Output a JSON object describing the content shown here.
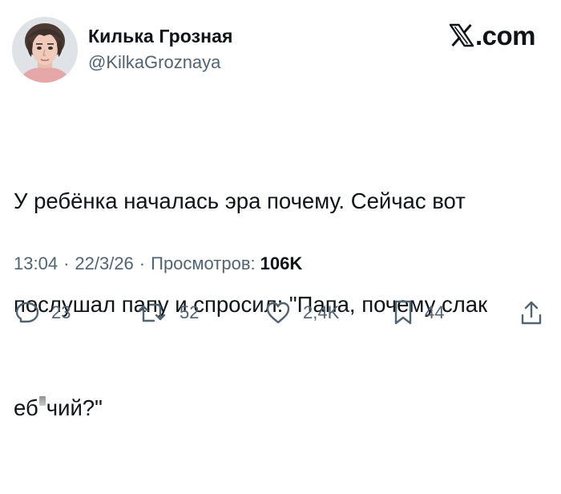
{
  "header": {
    "display_name": "Килька Грозная",
    "handle": "@KilkaGroznaya",
    "brand": "𝕏.com",
    "brand_text": ".com"
  },
  "tweet": {
    "line1": "У ребёнка началась эра почему. Сейчас вот",
    "line2": "послушал папу и спросил: \"Папа, почему слак",
    "line3_start": "еб",
    "line3_end": "чий?\""
  },
  "meta": {
    "time": "13:04",
    "separator": "·",
    "date": "22/3/26",
    "views_label": "Просмотров:",
    "views_count": "106K"
  },
  "actions": {
    "replies": "23",
    "reposts": "52",
    "likes": "2,4K",
    "bookmarks": "44"
  },
  "icons": {
    "avatar": "avatar-photo",
    "brand": "x-logo-icon",
    "reply": "reply-icon",
    "repost": "repost-icon",
    "like": "heart-icon",
    "bookmark": "bookmark-icon",
    "share": "share-icon"
  },
  "colors": {
    "text": "#0f1419",
    "secondary": "#536471",
    "background": "#ffffff"
  }
}
